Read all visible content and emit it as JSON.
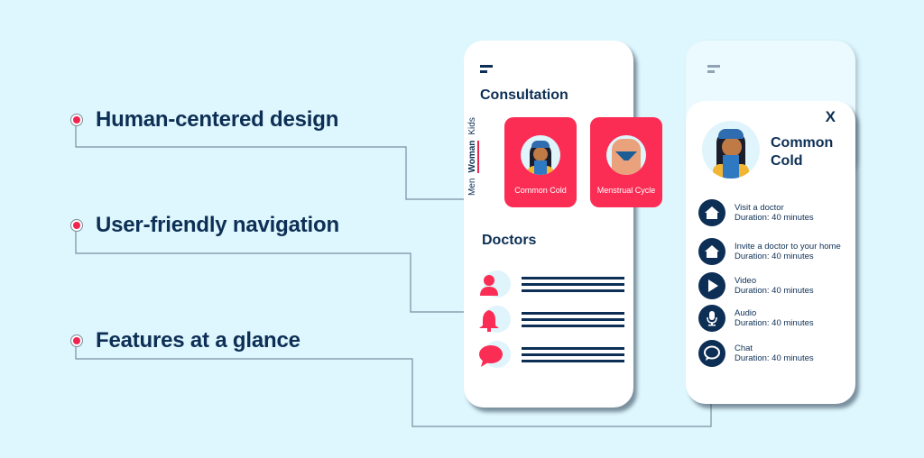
{
  "features": [
    {
      "label": "Human-centered design"
    },
    {
      "label": "User-friendly navigation"
    },
    {
      "label": "Features at a glance"
    }
  ],
  "colors": {
    "background": "#def6fd",
    "accent": "#fb2d55",
    "navy": "#0d2f55"
  },
  "consultation_screen": {
    "title": "Consultation",
    "tabs": [
      {
        "label": "Men",
        "active": false
      },
      {
        "label": "Woman",
        "active": true
      },
      {
        "label": "Kids",
        "active": false
      }
    ],
    "cards": [
      {
        "label": "Common Cold",
        "icon": "sick-girl-illustration"
      },
      {
        "label": "Menstrual Cycle",
        "icon": "torso-illustration"
      }
    ],
    "doctors_title": "Doctors",
    "doctor_rows": [
      {
        "icon": "user-icon"
      },
      {
        "icon": "bell-icon"
      },
      {
        "icon": "chat-bubble-icon"
      }
    ]
  },
  "detail_screen": {
    "close_label": "X",
    "title": "Common Cold",
    "options": [
      {
        "name": "Visit a doctor",
        "duration": "Duration: 40 minutes",
        "icon": "home-icon"
      },
      {
        "name": "Invite a doctor to your home",
        "duration": "Duration: 40 minutes",
        "icon": "home-icon"
      },
      {
        "name": "Video",
        "duration": "Duration: 40 minutes",
        "icon": "play-icon"
      },
      {
        "name": "Audio",
        "duration": "Duration: 40 minutes",
        "icon": "microphone-icon"
      },
      {
        "name": "Chat",
        "duration": "Duration: 40 minutes",
        "icon": "chat-icon"
      }
    ]
  }
}
